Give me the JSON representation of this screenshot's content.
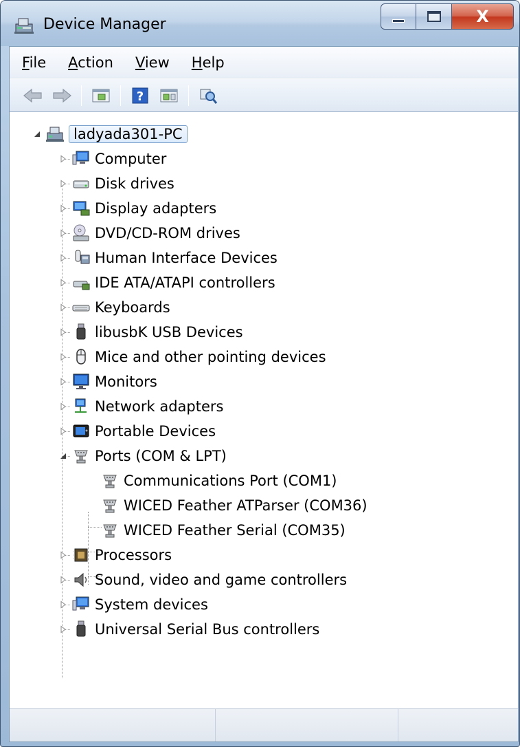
{
  "window": {
    "title": "Device Manager",
    "caption": {
      "minimize": "–",
      "maximize": "□",
      "close": "X"
    }
  },
  "menu": [
    {
      "accel": "F",
      "rest": "ile"
    },
    {
      "accel": "A",
      "rest": "ction"
    },
    {
      "accel": "V",
      "rest": "iew"
    },
    {
      "accel": "H",
      "rest": "elp"
    }
  ],
  "toolbar": {
    "buttons": [
      "back-arrow-icon",
      "forward-arrow-icon",
      "show-hide-console-tree-icon",
      "help-icon",
      "action-pane-icon",
      "scan-hardware-icon"
    ]
  },
  "tree": {
    "root": {
      "label": "ladyada301-PC",
      "expanded": true
    },
    "categories": [
      {
        "label": "Computer",
        "icon": "computer-icon"
      },
      {
        "label": "Disk drives",
        "icon": "disk-drive-icon"
      },
      {
        "label": "Display adapters",
        "icon": "display-adapter-icon"
      },
      {
        "label": "DVD/CD-ROM drives",
        "icon": "dvd-drive-icon"
      },
      {
        "label": "Human Interface Devices",
        "icon": "hid-icon"
      },
      {
        "label": "IDE ATA/ATAPI controllers",
        "icon": "ide-controller-icon"
      },
      {
        "label": "Keyboards",
        "icon": "keyboard-icon"
      },
      {
        "label": "libusbK USB Devices",
        "icon": "usb-plug-icon"
      },
      {
        "label": "Mice and other pointing devices",
        "icon": "mouse-icon"
      },
      {
        "label": "Monitors",
        "icon": "monitor-icon"
      },
      {
        "label": "Network adapters",
        "icon": "network-adapter-icon"
      },
      {
        "label": "Portable Devices",
        "icon": "portable-device-icon"
      },
      {
        "label": "Ports (COM & LPT)",
        "icon": "port-icon",
        "expanded": true,
        "children": [
          {
            "label": "Communications Port (COM1)",
            "icon": "port-icon"
          },
          {
            "label": "WICED Feather ATParser (COM36)",
            "icon": "port-icon"
          },
          {
            "label": "WICED Feather Serial (COM35)",
            "icon": "port-icon"
          }
        ]
      },
      {
        "label": "Processors",
        "icon": "processor-icon"
      },
      {
        "label": "Sound, video and game controllers",
        "icon": "speaker-icon"
      },
      {
        "label": "System devices",
        "icon": "system-device-icon"
      },
      {
        "label": "Universal Serial Bus controllers",
        "icon": "usb-plug-icon"
      }
    ]
  },
  "colors": {
    "title_bar": "#b2c9e2",
    "close_button": "#c4371e",
    "selection_border": "#7da2ce"
  }
}
